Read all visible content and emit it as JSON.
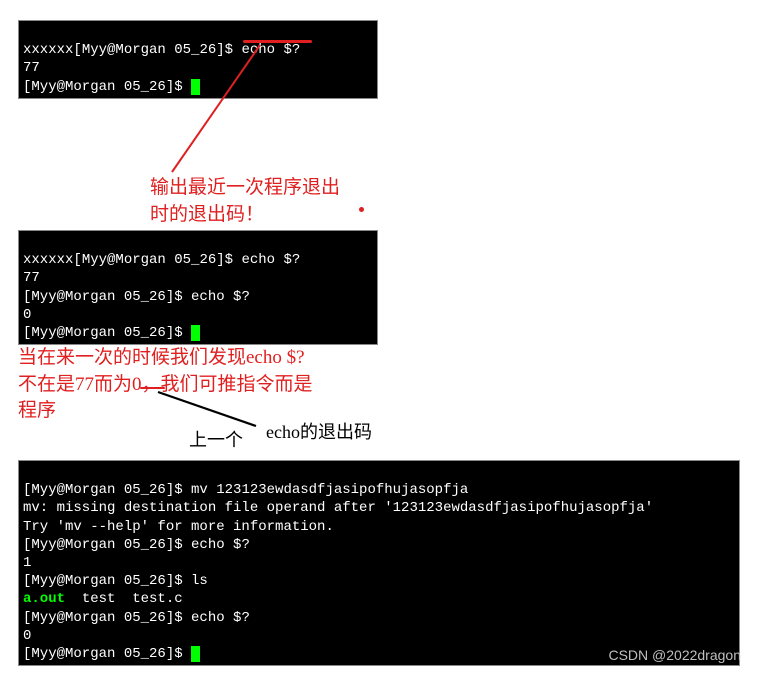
{
  "terminal1": {
    "line1_prefix": "xxxxxx",
    "line1_prompt": "[Myy@Morgan 05_26]$ ",
    "line1_cmd": "echo $?",
    "line2": "77",
    "line3_prompt": "[Myy@Morgan 05_26]$ "
  },
  "annotation1": "输出最近一次程序退出\n时的退出码！",
  "terminal2": {
    "line1_prefix": "xxxxxx",
    "line1_prompt": "[Myy@Morgan 05_26]$ ",
    "line1_cmd": "echo $?",
    "line2": "77",
    "line3_prompt": "[Myy@Morgan 05_26]$ ",
    "line3_cmd": "echo $?",
    "line4": "0",
    "line5_prompt": "[Myy@Morgan 05_26]$ "
  },
  "annotation2": "当在来一次的时候我们发现echo $?\n不在是77而为0，我们可推指令而是\n程序",
  "annotation3": "上一个",
  "annotation4": "echo的退出码",
  "terminal3": {
    "line1_prompt": "[Myy@Morgan 05_26]$ ",
    "line1_cmd": "mv 123123ewdasdfjasipofhujasopfja",
    "line2": "mv: missing destination file operand after '123123ewdasdfjasipofhujasopfja'",
    "line3": "Try 'mv --help' for more information.",
    "line4_prompt": "[Myy@Morgan 05_26]$ ",
    "line4_cmd": "echo $?",
    "line5": "1",
    "line6_prompt": "[Myy@Morgan 05_26]$ ",
    "line6_cmd": "ls",
    "line7_green": "a.out",
    "line7_rest": "  test  test.c",
    "line8_prompt": "[Myy@Morgan 05_26]$ ",
    "line8_cmd": "echo $?",
    "line9": "0",
    "line10_prompt": "[Myy@Morgan 05_26]$ "
  },
  "watermark": "CSDN @2022dragon"
}
